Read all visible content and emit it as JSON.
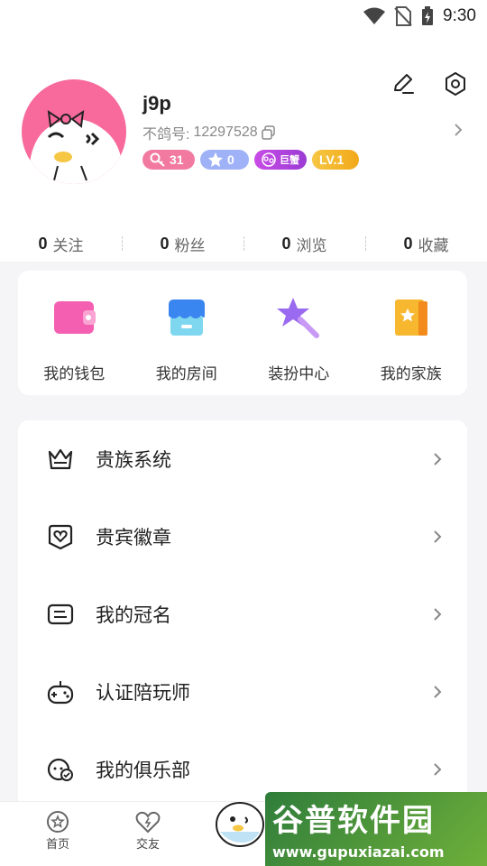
{
  "status_bar": {
    "time": "9:30"
  },
  "profile": {
    "username": "j9p",
    "uid_label": "不鸽号:",
    "uid": "12297528",
    "badges": [
      {
        "type": "fans-level",
        "value": "31",
        "color": "#f27aa0"
      },
      {
        "type": "star",
        "value": "0",
        "color": "#9fb2f7"
      },
      {
        "type": "noble",
        "value": "巨蟹",
        "color": "#c84ce6"
      },
      {
        "type": "level",
        "value": "LV.1",
        "color": "#f2a818"
      }
    ]
  },
  "stats": [
    {
      "num": "0",
      "label": "关注"
    },
    {
      "num": "0",
      "label": "粉丝"
    },
    {
      "num": "0",
      "label": "浏览"
    },
    {
      "num": "0",
      "label": "收藏"
    }
  ],
  "quick_actions": [
    {
      "label": "我的钱包",
      "icon": "wallet-icon"
    },
    {
      "label": "我的房间",
      "icon": "room-icon"
    },
    {
      "label": "装扮中心",
      "icon": "wand-icon"
    },
    {
      "label": "我的家族",
      "icon": "family-book-icon"
    }
  ],
  "menu": [
    {
      "label": "贵族系统",
      "icon": "crown-icon"
    },
    {
      "label": "贵宾徽章",
      "icon": "badge-heart-icon"
    },
    {
      "label": "我的冠名",
      "icon": "title-card-icon"
    },
    {
      "label": "认证陪玩师",
      "icon": "gamepad-icon"
    },
    {
      "label": "我的俱乐部",
      "icon": "club-icon"
    }
  ],
  "bottom_nav": [
    {
      "label": "首页",
      "icon": "home-icon"
    },
    {
      "label": "交友",
      "icon": "heart-icon"
    }
  ],
  "watermark": {
    "logo": "谷普软件园",
    "url": "www.gupuxiazai.com"
  },
  "colors": {
    "accent_pink": "#f76a9b",
    "gold": "#f2a818",
    "purple": "#9b3bd4"
  }
}
